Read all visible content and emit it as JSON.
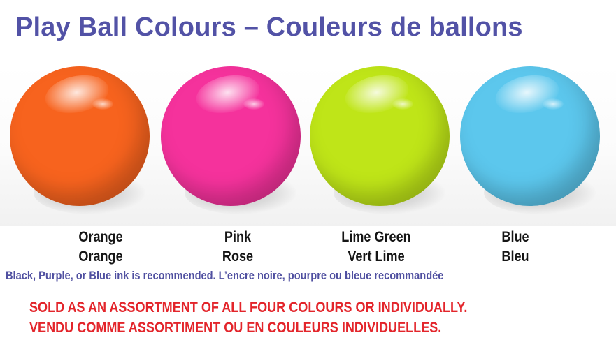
{
  "title": "Play Ball Colours – Couleurs de ballons",
  "balls": [
    {
      "icon": "orange-ball-icon",
      "color": "#f7631e",
      "label_en": "Orange",
      "label_fr": "Orange"
    },
    {
      "icon": "pink-ball-icon",
      "color": "#f5329c",
      "label_en": "Pink",
      "label_fr": "Rose"
    },
    {
      "icon": "lime-green-ball-icon",
      "color": "#bfe518",
      "label_en": "Lime Green",
      "label_fr": "Vert Lime"
    },
    {
      "icon": "blue-ball-icon",
      "color": "#5cc7ed",
      "label_en": "Blue",
      "label_fr": "Bleu"
    }
  ],
  "colors": {
    "title": "#5252a6",
    "note": "#4f4fa0",
    "sold": "#e3252b"
  },
  "note": "Black, Purple, or Blue ink is recommended. L’encre noire, pourpre ou bleue recommandée",
  "sold_line_en": "SOLD AS AN ASSORTMENT OF ALL FOUR COLOURS OR INDIVIDUALLY.",
  "sold_line_fr": "VENDU COMME ASSORTIMENT OU EN COULEURS INDIVIDUELLES."
}
